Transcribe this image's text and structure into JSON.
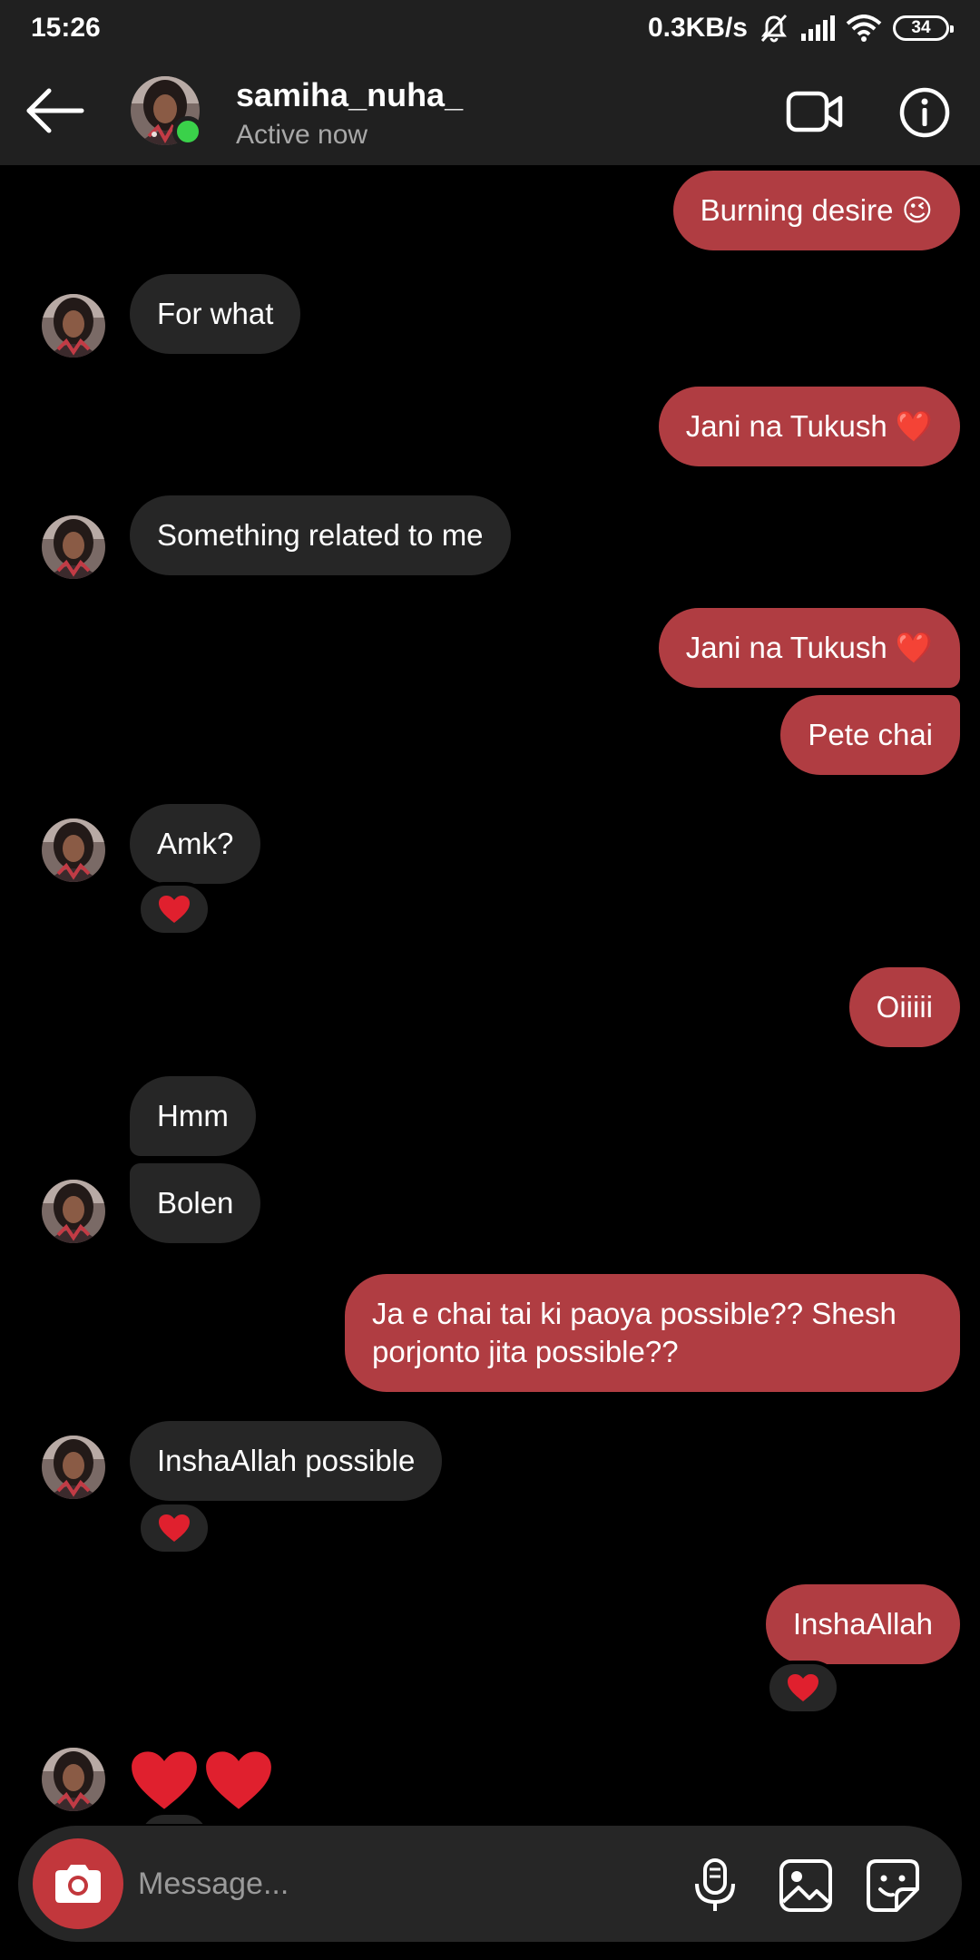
{
  "status_bar": {
    "time": "15:26",
    "network_speed": "0.3KB/s",
    "battery": "34"
  },
  "header": {
    "username": "samiha_nuha_",
    "status": "Active now"
  },
  "messages": [
    {
      "from": "me",
      "text": "Burning desire 😉"
    },
    {
      "from": "them",
      "text": "For what"
    },
    {
      "from": "me",
      "text": "Jani na Tukush ❤️"
    },
    {
      "from": "them",
      "text": "Something related to me"
    },
    {
      "from": "me",
      "text": "Jani na Tukush ❤️"
    },
    {
      "from": "me",
      "text": "Pete chai"
    },
    {
      "from": "them",
      "text": "Amk?",
      "reaction": "heart"
    },
    {
      "from": "me",
      "text": "Oiiiii"
    },
    {
      "from": "them",
      "text": "Hmm"
    },
    {
      "from": "them",
      "text": "Bolen"
    },
    {
      "from": "me",
      "text": "Ja e chai tai ki paoya possible?? Shesh porjonto jita possible??"
    },
    {
      "from": "them",
      "text": "InshaAllah possible",
      "reaction": "heart"
    },
    {
      "from": "me",
      "text": "InshaAllah",
      "reaction": "heart"
    },
    {
      "from": "them",
      "text": "",
      "content": "two-red-hearts"
    }
  ],
  "composer": {
    "placeholder": "Message..."
  },
  "colors": {
    "outgoing_bubble": "#b03d42",
    "incoming_bubble": "#262626",
    "background": "#000000",
    "online": "#3ad14a",
    "heart": "#e0202e"
  }
}
